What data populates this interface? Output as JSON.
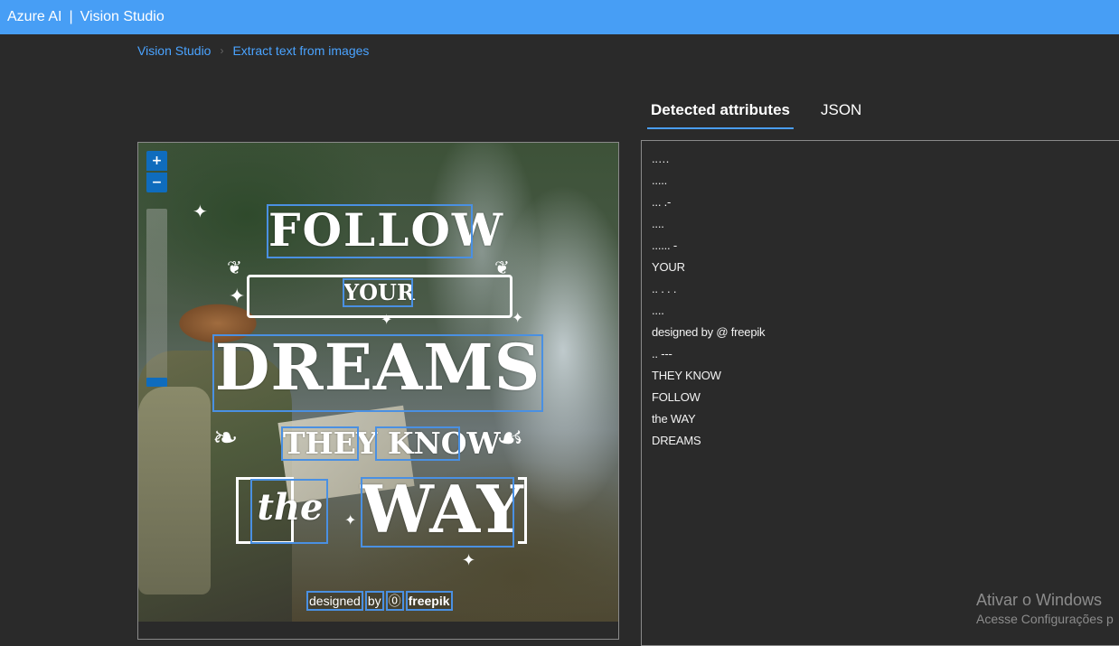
{
  "app": {
    "brand": "Azure AI",
    "separator": "|",
    "product": "Vision Studio"
  },
  "breadcrumb": {
    "items": [
      "Vision Studio",
      "Extract text from images"
    ],
    "separator": "›"
  },
  "image_viewer": {
    "zoom_in_label": "+",
    "zoom_out_label": "−",
    "artwork": {
      "follow": "FOLLOW",
      "your": "YOUR",
      "dreams": "DREAMS",
      "they_know": "THEY KNOW",
      "the": "the",
      "way": "WAY"
    },
    "credit": {
      "word1": "designed",
      "word2": "by",
      "icon": "freepik-logo-icon",
      "word3": "freepik"
    },
    "box_color": "#4a90e2"
  },
  "tabs": [
    {
      "label": "Detected attributes",
      "active": true
    },
    {
      "label": "JSON",
      "active": false
    }
  ],
  "results": {
    "lines": [
      "..…",
      ".....",
      "... .-",
      "....",
      "...... -",
      "YOUR",
      ".. . . .",
      "....",
      "designed by @ freepik",
      ".. ---",
      "THEY KNOW",
      "FOLLOW",
      "the WAY",
      "DREAMS"
    ]
  },
  "watermark": {
    "title": "Ativar o Windows",
    "subtitle": "Acesse Configurações p"
  },
  "colors": {
    "topbar": "#479ef5",
    "background": "#2a2a2a",
    "accent": "#0f6cbd",
    "link": "#4aa3ff"
  }
}
